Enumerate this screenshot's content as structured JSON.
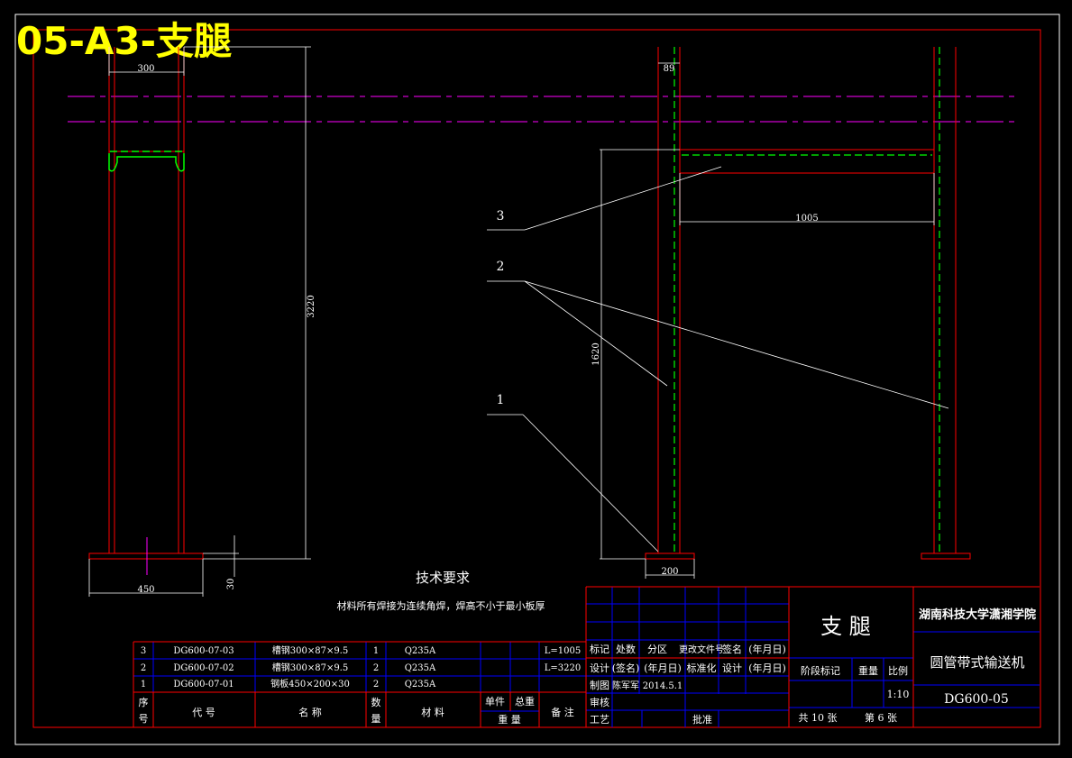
{
  "sheet_label": "05-A3-支腿",
  "dimensions": {
    "flange_width": "300",
    "column_height": "3220",
    "base_width_left": "450",
    "base_thickness": "30",
    "web_width": "89",
    "beam_length": "1005",
    "beam_height": "1620",
    "base_width_right": "200"
  },
  "balloons": [
    "3",
    "2",
    "1"
  ],
  "tech_requirements": {
    "title": "技术要求",
    "text": "材料所有焊接为连续角焊，焊高不小于最小板厚"
  },
  "bom": {
    "rows": [
      {
        "no": "3",
        "code": "DG600-07-03",
        "name": "槽钢300×87×9.5",
        "qty": "1",
        "material": "Q235A",
        "unit_w": "",
        "total_w": "",
        "note": "L=1005"
      },
      {
        "no": "2",
        "code": "DG600-07-02",
        "name": "槽钢300×87×9.5",
        "qty": "2",
        "material": "Q235A",
        "unit_w": "",
        "total_w": "",
        "note": "L=3220"
      },
      {
        "no": "1",
        "code": "DG600-07-01",
        "name": "钢板450×200×30",
        "qty": "2",
        "material": "Q235A",
        "unit_w": "",
        "total_w": "",
        "note": ""
      }
    ],
    "header": {
      "no_1": "序",
      "no_2": "号",
      "code": "代        号",
      "name": "名        称",
      "qty_1": "数",
      "qty_2": "量",
      "material": "材        料",
      "unit_w": "单件",
      "total_w": "总重",
      "weight": "重        量",
      "note": "备  注"
    }
  },
  "title_block": {
    "part_name": "支  腿",
    "school": "湖南科技大学潇湘学院",
    "product": "圆管带式输送机",
    "drawing_no": "DG600-05",
    "rev_row": [
      "标记",
      "处数",
      "分区",
      "更改文件号",
      "签名",
      "(年月日)"
    ],
    "design_row": [
      "设计",
      "(签名)",
      "(年月日)",
      "标准化",
      "设计",
      "(年月日)"
    ],
    "drafted_label": "制图",
    "drafter": "陈军军",
    "date": "2014.5.1",
    "review_label": "审核",
    "process_label": "工艺",
    "approve_label": "批准",
    "stage_label": "阶段标记",
    "weight_label": "重量",
    "scale_label": "比例",
    "scale": "1:10",
    "sheet_total": "共 10 张",
    "sheet_no": "第 6 张"
  },
  "colors": {
    "background": "#000000",
    "frame": "#ff0000",
    "dimension": "#ffffff",
    "centerline": "#ff00ff",
    "hidden": "#00ff00",
    "table_grid": "#0000ff",
    "sheet_label": "#ffff00"
  }
}
